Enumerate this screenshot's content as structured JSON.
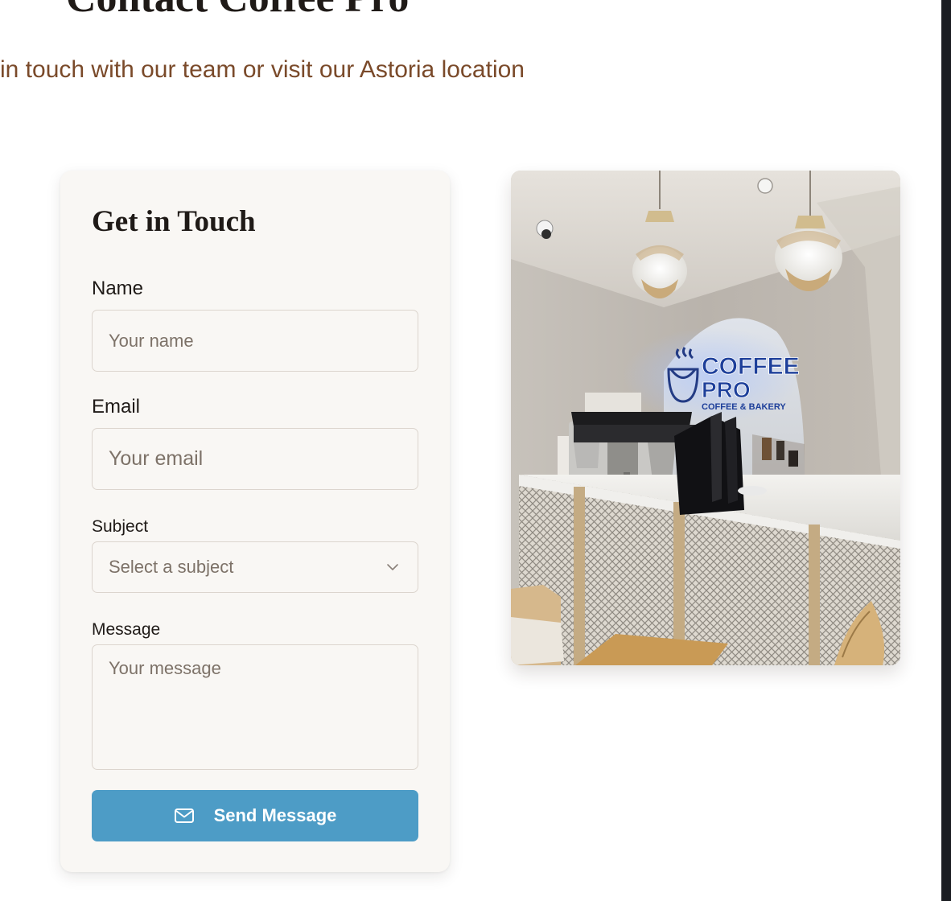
{
  "hero": {
    "title": "Contact Coffee Pro",
    "subtitle": "in touch with our team or visit our Astoria location"
  },
  "form": {
    "title": "Get in Touch",
    "name": {
      "label": "Name",
      "placeholder": "Your name"
    },
    "email": {
      "label": "Email",
      "placeholder": "Your email"
    },
    "subject": {
      "label": "Subject",
      "selected": "Select a subject"
    },
    "message": {
      "label": "Message",
      "placeholder": "Your message"
    },
    "submit": {
      "label": "Send Message",
      "icon": "mail-icon"
    }
  },
  "photo": {
    "sign_line1": "COFFEE",
    "sign_line2": "PRO",
    "sign_line3": "COFFEE & BAKERY"
  },
  "colors": {
    "accent": "#4d9cc6",
    "subtitle": "#7a4a2a",
    "card_background": "#f9f7f4",
    "heading": "#1f1a17"
  }
}
